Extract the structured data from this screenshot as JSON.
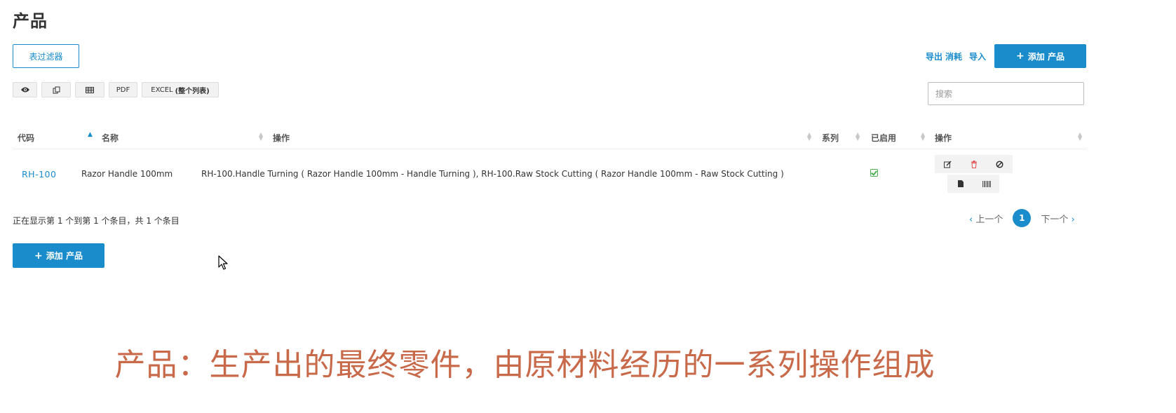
{
  "page": {
    "title": "产品"
  },
  "filter_button": {
    "label": "表过滤器"
  },
  "top_links": {
    "export": "导出",
    "consume": "消耗",
    "import": "导入"
  },
  "add_button": {
    "plus": "+",
    "label": "添加 产品"
  },
  "tool_buttons": {
    "view_icon": "eye-icon",
    "copy_icon": "copy-icon",
    "columns_icon": "table-icon",
    "pdf": "PDF",
    "excel_prefix": "EXCEL",
    "excel_suffix": "(整个列表)"
  },
  "search": {
    "placeholder": "搜索"
  },
  "table": {
    "columns": [
      "代码",
      "名称",
      "操作",
      "系列",
      "已启用",
      "操作"
    ],
    "sorted_column": "名称",
    "rows": [
      {
        "code": "RH-100",
        "name": "Razor Handle 100mm",
        "operations": "RH-100.Handle Turning ( Razor Handle 100mm - Handle Turning ), RH-100.Raw Stock Cutting ( Razor Handle 100mm - Raw Stock Cutting )",
        "series": "",
        "enabled": true
      }
    ]
  },
  "row_actions": [
    "edit-icon",
    "trash-icon",
    "ban-icon",
    "document-icon",
    "barcode-icon"
  ],
  "info": "正在显示第 1 个到第 1 个条目，共 1 个条目",
  "pager": {
    "prev": "上一个",
    "current": "1",
    "next": "下一个"
  },
  "caption": "产品：生产出的最终零件，由原材料经历的一系列操作组成",
  "colors": {
    "accent": "#1a8ccc",
    "caption": "#c8694a",
    "enabled": "#4caf50",
    "delete": "#e05050"
  }
}
